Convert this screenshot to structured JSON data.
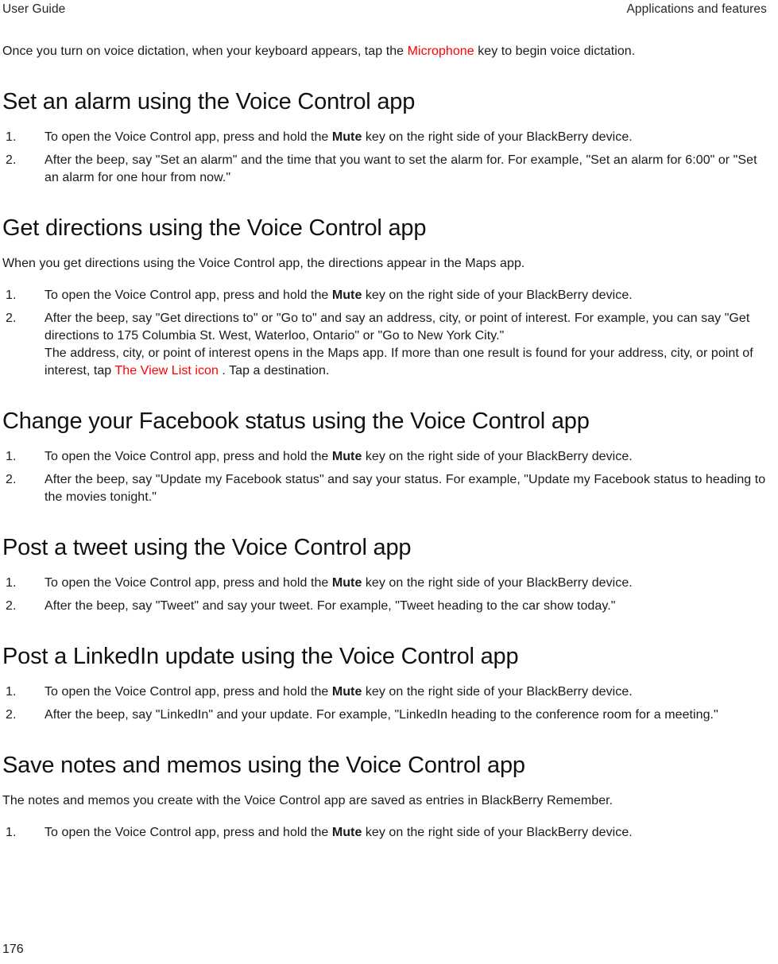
{
  "header": {
    "left": "User Guide",
    "right": "Applications and features"
  },
  "footer": {
    "page_number": "176"
  },
  "colors": {
    "link_red": "#ff0000",
    "text": "#1a1a1a",
    "heading": "#111111"
  },
  "intro": {
    "before_link": "Once you turn on voice dictation, when your keyboard appears, tap the ",
    "link": "Microphone",
    "after_link": " key to begin voice dictation."
  },
  "common": {
    "step_open_app_before": "To open the Voice Control app, press and hold the ",
    "step_open_app_key": "Mute",
    "step_open_app_after": " key on the right side of your BlackBerry device.",
    "num_1": "1.",
    "num_2": "2."
  },
  "sections": [
    {
      "id": "set-alarm",
      "title": "Set an alarm using the Voice Control app",
      "intro": null,
      "step2": "After the beep, say \"Set an alarm\" and the time that you want to set the alarm for. For example, \"Set an alarm for 6:00\" or \"Set an alarm for one hour from now.\""
    },
    {
      "id": "get-directions",
      "title": "Get directions using the Voice Control app",
      "intro": "When you get directions using the Voice Control app, the directions appear in the Maps app.",
      "step2_part1": "After the beep, say \"Get directions to\" or \"Go to\" and say an address, city, or point of interest. For example, you can say \"Get directions to 175 Columbia St. West, Waterloo, Ontario\" or \"Go to New York City.\"",
      "step2_part2_before_link": "The address, city, or point of interest opens in the Maps app. If more than one result is found for your address, city, or point of interest, tap ",
      "step2_link": "The View List icon",
      "step2_part2_after_link": " . Tap a destination."
    },
    {
      "id": "facebook-status",
      "title": "Change your Facebook status using the Voice Control app",
      "intro": null,
      "step2": "After the beep, say \"Update my Facebook status\" and say your status. For example, \"Update my Facebook status to heading to the movies tonight.\""
    },
    {
      "id": "post-tweet",
      "title": "Post a tweet using the Voice Control app",
      "intro": null,
      "step2": "After the beep, say \"Tweet\" and say your tweet. For example, \"Tweet heading to the car show today.\""
    },
    {
      "id": "linkedin-update",
      "title": "Post a LinkedIn update using the Voice Control app",
      "intro": null,
      "step2": "After the beep, say \"LinkedIn\" and your update. For example, \"LinkedIn heading to the conference room for a meeting.\""
    },
    {
      "id": "save-notes",
      "title": "Save notes and memos using the Voice Control app",
      "intro": "The notes and memos you create with the Voice Control app are saved as entries in BlackBerry Remember.",
      "step2": null
    }
  ]
}
